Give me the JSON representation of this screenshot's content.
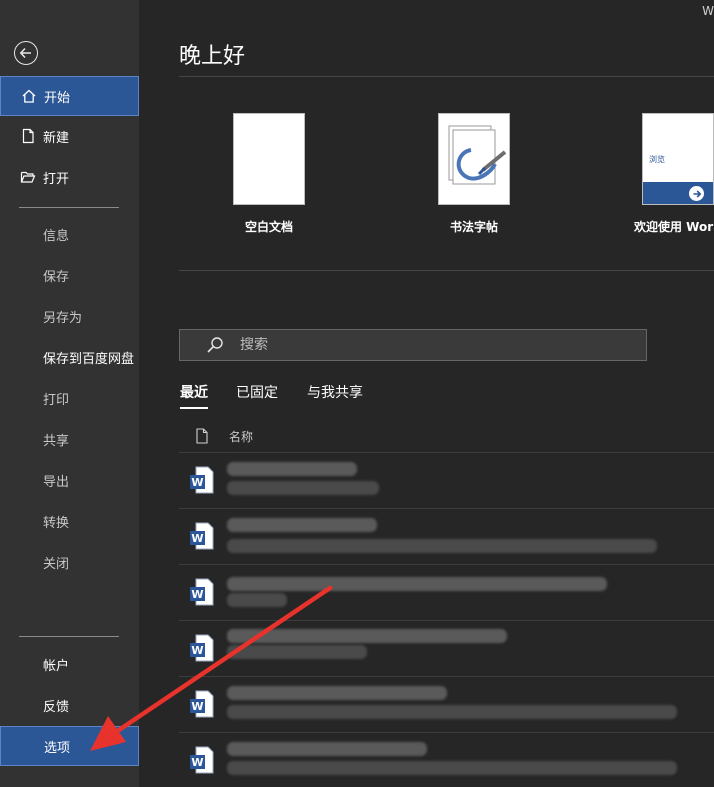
{
  "sidebar": {
    "back_icon": "back-arrow-icon",
    "primary": [
      {
        "label": "开始",
        "icon": "home-icon",
        "active": true
      },
      {
        "label": "新建",
        "icon": "new-document-icon"
      },
      {
        "label": "打开",
        "icon": "open-folder-icon"
      }
    ],
    "secondary": [
      {
        "label": "信息"
      },
      {
        "label": "保存"
      },
      {
        "label": "另存为"
      },
      {
        "label": "保存到百度网盘"
      },
      {
        "label": "打印"
      },
      {
        "label": "共享"
      },
      {
        "label": "导出"
      },
      {
        "label": "转换"
      },
      {
        "label": "关闭"
      }
    ],
    "bottom": [
      {
        "label": "帐户"
      },
      {
        "label": "反馈"
      },
      {
        "label": "选项",
        "active": true
      }
    ]
  },
  "main": {
    "title_fragment": "W",
    "greeting": "晚上好",
    "templates": [
      {
        "label": "空白文档"
      },
      {
        "label": "书法字帖"
      },
      {
        "label": "欢迎使用 Wor",
        "thumb_text": "浏览"
      }
    ],
    "search": {
      "placeholder": "搜索"
    },
    "tabs": [
      {
        "label": "最近",
        "active": true
      },
      {
        "label": "已固定"
      },
      {
        "label": "与我共享"
      }
    ],
    "list_header": {
      "name_label": "名称"
    }
  },
  "colors": {
    "sidebar_bg": "#323232",
    "main_bg": "#262626",
    "active_blue": "#2b5797",
    "word_blue": "#2b579a",
    "annotation_red": "#e8322c"
  }
}
